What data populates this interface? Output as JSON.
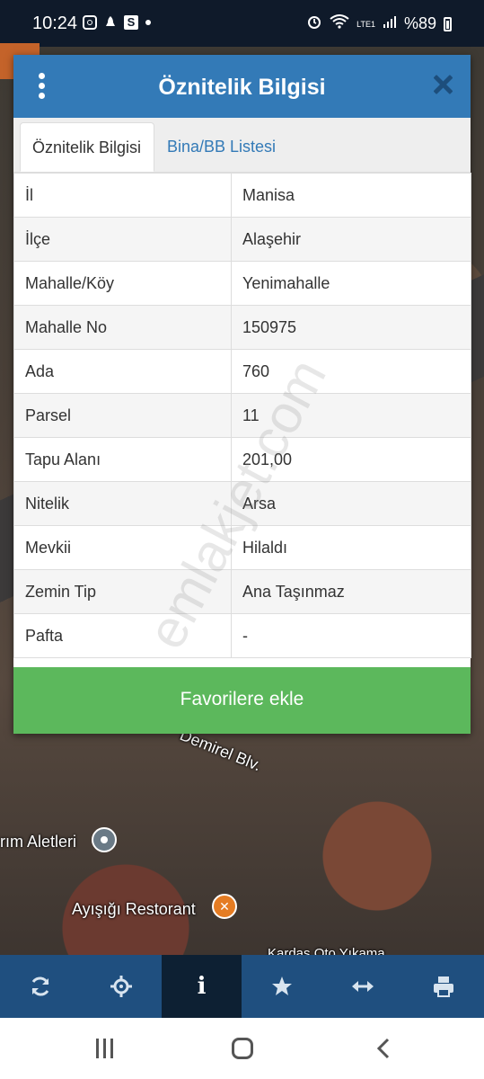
{
  "status_bar": {
    "time": "10:24",
    "right_text": "%89",
    "network_label": "LTE1",
    "icons": [
      "instagram-icon",
      "notification-icon",
      "s-app-icon",
      "dot-icon",
      "alarm-icon",
      "wifi-icon",
      "signal-icon",
      "battery-icon"
    ]
  },
  "map": {
    "labels": {
      "street": "Demirel Blv.",
      "poi_1": "rım Aletleri",
      "poi_2": "Ayışığı Restorant",
      "poi_3": "Kardaş Oto Yıkama"
    }
  },
  "dialog": {
    "title": "Öznitelik Bilgisi",
    "tabs": [
      {
        "label": "Öznitelik Bilgisi",
        "active": true
      },
      {
        "label": "Bina/BB Listesi",
        "active": false
      }
    ],
    "rows": [
      {
        "key": "İl",
        "value": "Manisa"
      },
      {
        "key": "İlçe",
        "value": "Alaşehir"
      },
      {
        "key": "Mahalle/Köy",
        "value": "Yenimahalle"
      },
      {
        "key": "Mahalle No",
        "value": "150975"
      },
      {
        "key": "Ada",
        "value": "760"
      },
      {
        "key": "Parsel",
        "value": "11"
      },
      {
        "key": "Tapu Alanı",
        "value": "201,00"
      },
      {
        "key": "Nitelik",
        "value": "Arsa"
      },
      {
        "key": "Mevkii",
        "value": "Hilaldı"
      },
      {
        "key": "Zemin Tip",
        "value": "Ana Taşınmaz"
      },
      {
        "key": "Pafta",
        "value": "-"
      }
    ],
    "favorite_button": "Favorilere ekle"
  },
  "watermark": "emlakjet.com",
  "toolbar": {
    "items": [
      {
        "icon": "refresh-icon",
        "active": false
      },
      {
        "icon": "crosshair-icon",
        "active": false
      },
      {
        "icon": "info-icon",
        "active": true
      },
      {
        "icon": "star-icon",
        "active": false
      },
      {
        "icon": "measure-arrows-icon",
        "active": false
      },
      {
        "icon": "print-icon",
        "active": false
      }
    ],
    "info_glyph": "i"
  },
  "colors": {
    "header_blue": "#337ab7",
    "toolbar_blue": "#1f4f7f",
    "favorite_green": "#5cb85c",
    "tab_link_blue": "#337ab7"
  }
}
